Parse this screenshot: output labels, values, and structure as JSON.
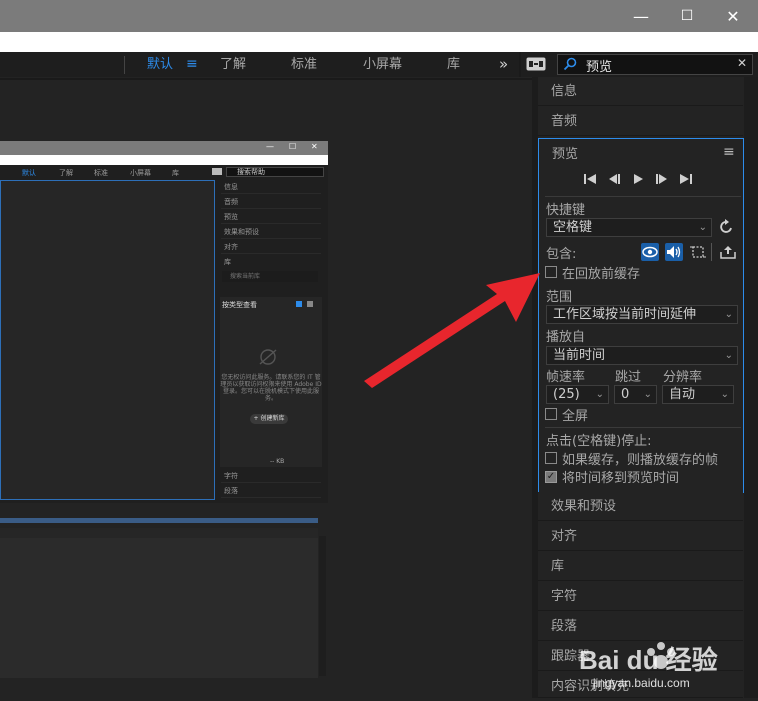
{
  "window": {
    "minimize": "—",
    "maximize": "☐",
    "close": "✕"
  },
  "workspaces": {
    "items": [
      "默认",
      "了解",
      "标准",
      "小屏幕",
      "库"
    ],
    "active": "默认",
    "overflow": "»",
    "menu_icon": "hamburger-icon"
  },
  "search": {
    "value": "预览",
    "clear": "✕",
    "icon": "search-icon",
    "sync_icon": "sync-settings-icon"
  },
  "right_panel": {
    "collapsed_top": [
      "信息",
      "音频"
    ],
    "collapsed_bottom": [
      "效果和预设",
      "对齐",
      "库",
      "字符",
      "段落",
      "跟踪器",
      "内容识别填充"
    ]
  },
  "preview_panel": {
    "title": "预览",
    "menu": "≡",
    "transport": [
      "⏮",
      "◀|",
      "▶",
      "|▶",
      "⏭"
    ],
    "shortcut_label": "快捷键",
    "shortcut_value": "空格键",
    "include_label": "包含:",
    "cache_before_label": "在回放前缓存",
    "cache_before_checked": false,
    "range_label": "范围",
    "range_value": "工作区域按当前时间延伸",
    "play_from_label": "播放自",
    "play_from_value": "当前时间",
    "frame_rate_label": "帧速率",
    "skip_label": "跳过",
    "resolution_label": "分辨率",
    "frame_rate_value": "(25)",
    "skip_value": "0",
    "resolution_value": "自动",
    "fullscreen_label": "全屏",
    "fullscreen_checked": false,
    "stop_label": "点击(空格键)停止:",
    "if_cached_label": "如果缓存，则播放缓存的帧",
    "if_cached_checked": false,
    "move_time_label": "将时间移到预览时间",
    "move_time_checked": true
  },
  "thumbnail": {
    "workspaces": [
      "默认",
      "了解",
      "标准",
      "小屏幕",
      "库"
    ],
    "search": "搜索帮助",
    "panels": [
      "信息",
      "音频",
      "预览",
      "效果和预设",
      "对齐",
      "库"
    ],
    "lib_search": "搜索当前库",
    "lib_view": "按类型查看",
    "lib_message": "您无权访问此服务。请联系您的 IT 管理员以获取访问权限来使用 Adobe ID 登录。您可以在脱机模式下使用此服务。",
    "lib_create": "+ 创建新库",
    "lib_size": "-- KB",
    "bottom_panels": [
      "字符",
      "段落"
    ]
  },
  "watermark": {
    "brand": "Bai du 经验",
    "url": "jingyan.baidu.com"
  },
  "colors": {
    "accent": "#2d8ceb",
    "arrow": "#e8262d",
    "panel_bg": "#232323"
  }
}
